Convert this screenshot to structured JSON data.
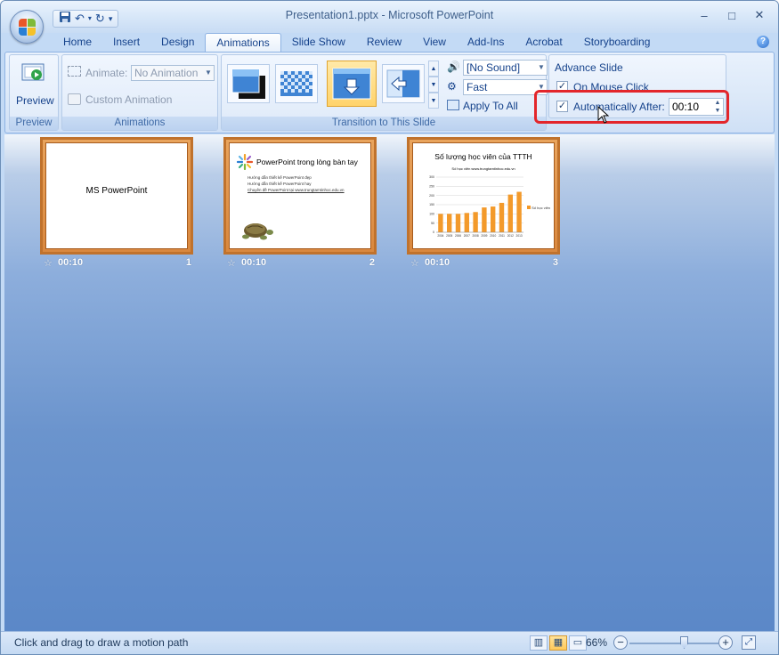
{
  "window": {
    "title": "Presentation1.pptx - Microsoft PowerPoint"
  },
  "qat": {
    "save_icon": "save-icon",
    "undo_icon": "undo-icon",
    "redo_icon": "redo-icon",
    "more_icon": "customize-icon"
  },
  "window_controls": {
    "minimize": "–",
    "maximize": "□",
    "close": "✕"
  },
  "tabs": [
    "Home",
    "Insert",
    "Design",
    "Animations",
    "Slide Show",
    "Review",
    "View",
    "Add-Ins",
    "Acrobat",
    "Storyboarding"
  ],
  "ribbon": {
    "preview": {
      "button_label": "Preview",
      "group_label": "Preview"
    },
    "animations": {
      "animate_label": "Animate:",
      "animate_value": "No Animation",
      "custom_animation": "Custom Animation",
      "group_label": "Animations"
    },
    "transition": {
      "sound": "[No Sound]",
      "speed": "Fast",
      "apply_all": "Apply To All",
      "group_label": "Transition to This Slide"
    },
    "advance": {
      "title": "Advance Slide",
      "on_mouse_click": "On Mouse Click",
      "on_mouse_click_checked": true,
      "auto_after": "Automatically After:",
      "auto_after_checked": true,
      "time_value": "00:10"
    }
  },
  "slides": [
    {
      "title": "MS PowerPoint",
      "time": "00:10",
      "number": "1"
    },
    {
      "title": "PowerPoint trong lòng bàn tay",
      "time": "00:10",
      "number": "2",
      "bullets": [
        "Hướng dẫn thiết kế PowerPoint đẹp",
        "Hướng dẫn thiết kế PowerPoint hay",
        "Chuyên đề PowerPoint tại www.trungtamtinhoc.edu.vn"
      ]
    },
    {
      "title": "Số lượng học viên của TTTH",
      "time": "00:10",
      "number": "3",
      "chart_subtitle": "Số học viên www.trungtamtinhoc.edu.vn",
      "chart_legend": "Số học viên"
    }
  ],
  "chart_data": {
    "type": "bar",
    "title": "Số lượng học viên của TTTH",
    "categories": [
      "2004",
      "2005",
      "2006",
      "2007",
      "2008",
      "2009",
      "2010",
      "2011",
      "2012",
      "2013"
    ],
    "values": [
      100,
      100,
      100,
      105,
      110,
      135,
      140,
      160,
      205,
      220
    ],
    "ylim": [
      0,
      300
    ],
    "series": [
      {
        "name": "Số học viên",
        "color": "#f39a2b"
      }
    ]
  },
  "status": {
    "message": "Click and drag to draw a motion path",
    "zoom": "66%",
    "zoom_level": 0.66
  }
}
